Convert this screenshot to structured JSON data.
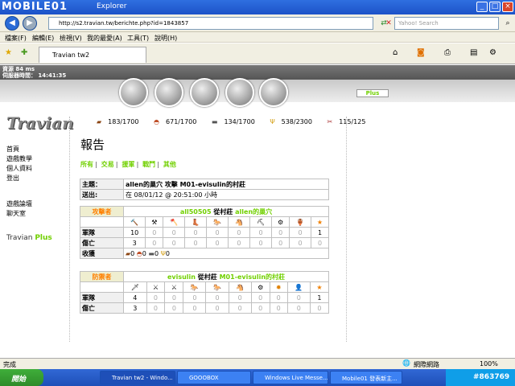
{
  "window": {
    "title": "Explorer",
    "watermark": "MOBILE01"
  },
  "nav": {
    "address": "http://s2.travian.tw/berichte.php?id=1843857",
    "search_placeholder": "Yahoo! Search"
  },
  "menu": [
    "檔案(F)",
    "編輯(E)",
    "檢視(V)",
    "我的最愛(A)",
    "工具(T)",
    "說明(H)"
  ],
  "tab": {
    "label": "Travian tw2"
  },
  "game": {
    "info_line1": "資源 84 ms",
    "info_line2": "伺服器時間： 14:41:35",
    "plus_button": "Plus",
    "logo_text": "Travian",
    "resources": [
      "183/1700",
      "671/1700",
      "134/1700",
      "538/2300",
      "115/125"
    ],
    "sidebar_links": [
      "首頁",
      "遊戲教學",
      "個人資料",
      "登出",
      "遊戲論壇",
      "聊天室"
    ],
    "plus_label_a": "Travian",
    "plus_label_b": "Plus",
    "page_title": "報告",
    "subnav": [
      "所有",
      "交易",
      "援軍",
      "戰鬥",
      "其他"
    ],
    "report": {
      "subject_label": "主題：",
      "subject_value": "allen的巢穴 攻擊 M01-evisulin的村莊",
      "sent_label": "送出:",
      "sent_value": "在 08/01/12 @ 20:51:00 小時",
      "attacker_label": "攻擊者",
      "attacker_name": "all50505",
      "attacker_from": "從村莊",
      "attacker_village": "allen的巢穴",
      "troops_label": "軍隊",
      "casualties_label": "傷亡",
      "loot_label": "收獲",
      "attacker_troops": [
        "10",
        "0",
        "0",
        "0",
        "0",
        "0",
        "0",
        "0",
        "0",
        "1"
      ],
      "attacker_losses": [
        "3",
        "0",
        "0",
        "0",
        "0",
        "0",
        "0",
        "0",
        "0",
        "0"
      ],
      "loot": [
        "0",
        "0",
        "0",
        "0"
      ],
      "defender_label": "防禦者",
      "defender_name": "evisulin",
      "defender_from": "從村莊",
      "defender_village": "M01-evisulin的村莊",
      "defender_troops": [
        "4",
        "0",
        "0",
        "0",
        "0",
        "0",
        "0",
        "0",
        "0",
        "1"
      ],
      "defender_losses": [
        "3",
        "0",
        "0",
        "0",
        "0",
        "0",
        "0",
        "0",
        "0",
        "0"
      ]
    }
  },
  "status": {
    "left": "完成",
    "zone": "網際網路",
    "zoom": "100%"
  },
  "taskbar": {
    "start": "開始",
    "items": [
      "Travian tw2 - Windo...",
      "GOOOBOX",
      "Windows Live Messe...",
      "Mobile01 發表新主..."
    ],
    "tray": "#863769"
  }
}
